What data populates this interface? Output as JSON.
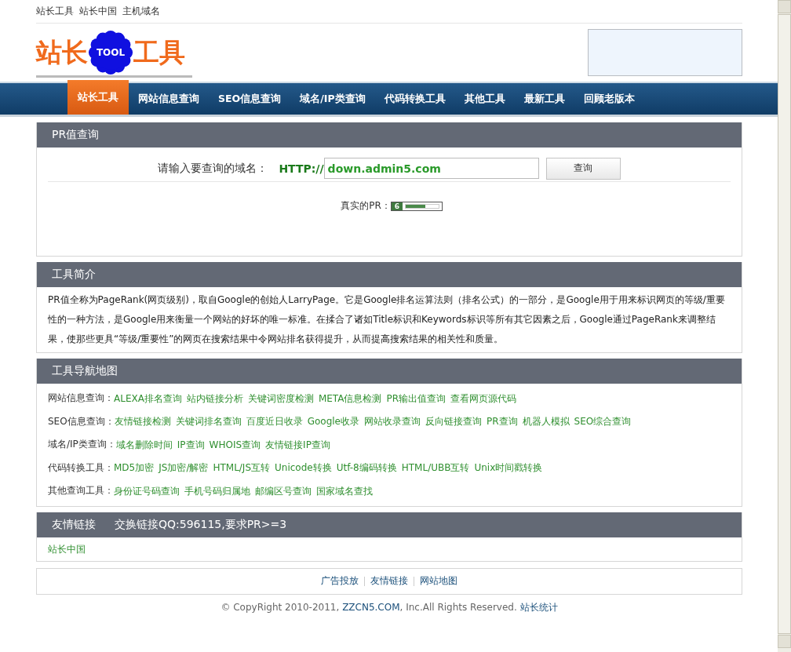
{
  "top_links": [
    "站长工具",
    "站长中国",
    "主机域名"
  ],
  "logo": {
    "left": "站长",
    "badge": "TOOL",
    "right": "工具"
  },
  "nav": [
    {
      "label": "站长工具",
      "selected": true
    },
    {
      "label": "网站信息查询",
      "selected": false
    },
    {
      "label": "SEO信息查询",
      "selected": false
    },
    {
      "label": "域名/IP类查询",
      "selected": false
    },
    {
      "label": "代码转换工具",
      "selected": false
    },
    {
      "label": "其他工具",
      "selected": false
    },
    {
      "label": "最新工具",
      "selected": false
    },
    {
      "label": "回顾老版本",
      "selected": false
    }
  ],
  "pr_panel": {
    "title": "PR值查询",
    "prompt": "请输入要查询的域名：",
    "prefix": "HTTP://",
    "value": "down.admin5.com",
    "button": "查询",
    "result_label": "真实的PR：",
    "pr_value": "6",
    "level": 0.6
  },
  "intro_panel": {
    "title": "工具简介",
    "text": "PR值全称为PageRank(网页级别)，取自Google的创始人LarryPage。它是Google排名运算法则（排名公式）的一部分，是Google用于用来标识网页的等级/重要性的一种方法，是Google用来衡量一个网站的好坏的唯一标准。在揉合了诸如Title标识和Keywords标识等所有其它因素之后，Google通过PageRank来调整结果，使那些更具“等级/重要性”的网页在搜索结果中令网站排名获得提升，从而提高搜索结果的相关性和质量。"
  },
  "map_panel": {
    "title": "工具导航地图",
    "groups": [
      {
        "label": "网站信息查询：",
        "links": [
          "ALEXA排名查询",
          "站内链接分析",
          "关键词密度检测",
          "META信息检测",
          "PR输出值查询",
          "查看网页源代码"
        ]
      },
      {
        "label": "SEO信息查询：",
        "links": [
          "友情链接检测",
          "关键词排名查询",
          "百度近日收录",
          "Google收录",
          "网站收录查询",
          "反向链接查询",
          "PR查询",
          "机器人模拟",
          "SEO综合查询"
        ]
      },
      {
        "label": "域名/IP类查询：",
        "links": [
          "域名删除时间",
          "IP查询",
          "WHOIS查询",
          "友情链接IP查询"
        ]
      },
      {
        "label": "代码转换工具：",
        "links": [
          "MD5加密",
          "JS加密/解密",
          "HTML/JS互转",
          "Unicode转换",
          "Utf-8编码转换",
          "HTML/UBB互转",
          "Unix时间戳转换"
        ]
      },
      {
        "label": "其他查询工具：",
        "links": [
          "身份证号码查询",
          "手机号码归属地",
          "邮编区号查询",
          "国家域名查找"
        ]
      }
    ]
  },
  "links_panel": {
    "title": "友情链接",
    "note": "交换链接QQ:596115,要求PR>=3",
    "links": [
      "站长中国"
    ]
  },
  "footer_links": [
    "广告投放",
    "友情链接",
    "网站地图"
  ],
  "copyright": {
    "before": "© CopyRight 2010-2011, ",
    "link": "ZZCN5.COM",
    "after": ", Inc.All Rights Reserved. ",
    "stats_link": "站长统计"
  }
}
